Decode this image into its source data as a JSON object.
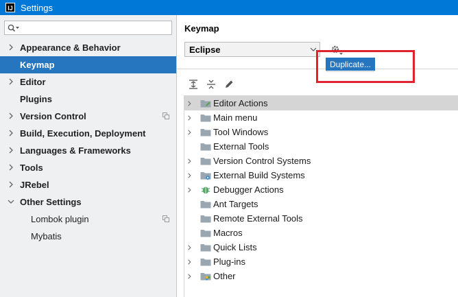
{
  "window": {
    "title": "Settings",
    "app_icon": "IJ"
  },
  "sidebar": {
    "search_placeholder": "",
    "items": [
      {
        "label": "Appearance & Behavior",
        "expandable": true,
        "selected": false
      },
      {
        "label": "Keymap",
        "expandable": false,
        "selected": true
      },
      {
        "label": "Editor",
        "expandable": true,
        "selected": false
      },
      {
        "label": "Plugins",
        "expandable": false,
        "selected": false
      },
      {
        "label": "Version Control",
        "expandable": true,
        "selected": false,
        "project_icon": true
      },
      {
        "label": "Build, Execution, Deployment",
        "expandable": true,
        "selected": false
      },
      {
        "label": "Languages & Frameworks",
        "expandable": true,
        "selected": false
      },
      {
        "label": "Tools",
        "expandable": true,
        "selected": false
      },
      {
        "label": "JRebel",
        "expandable": true,
        "selected": false
      },
      {
        "label": "Other Settings",
        "expandable": true,
        "expanded": true,
        "selected": false
      },
      {
        "label": "Lombok plugin",
        "child": true,
        "project_icon": true
      },
      {
        "label": "Mybatis",
        "child": true
      }
    ]
  },
  "main": {
    "heading": "Keymap",
    "keymap_select": {
      "value": "Eclipse"
    },
    "duplicate_label": "Duplicate...",
    "tree": [
      {
        "label": "Editor Actions",
        "expandable": true,
        "icon": "folder-edit-icon",
        "selected": true
      },
      {
        "label": "Main menu",
        "expandable": true,
        "icon": "folder-icon"
      },
      {
        "label": "Tool Windows",
        "expandable": true,
        "icon": "folder-icon"
      },
      {
        "label": "External Tools",
        "expandable": false,
        "icon": "folder-icon"
      },
      {
        "label": "Version Control Systems",
        "expandable": true,
        "icon": "folder-icon"
      },
      {
        "label": "External Build Systems",
        "expandable": true,
        "icon": "folder-gear-icon"
      },
      {
        "label": "Debugger Actions",
        "expandable": true,
        "icon": "bug-icon"
      },
      {
        "label": "Ant Targets",
        "expandable": false,
        "icon": "folder-icon"
      },
      {
        "label": "Remote External Tools",
        "expandable": false,
        "icon": "folder-icon"
      },
      {
        "label": "Macros",
        "expandable": false,
        "icon": "folder-icon"
      },
      {
        "label": "Quick Lists",
        "expandable": true,
        "icon": "folder-icon"
      },
      {
        "label": "Plug-ins",
        "expandable": true,
        "icon": "folder-icon"
      },
      {
        "label": "Other",
        "expandable": true,
        "icon": "folder-other-icon"
      }
    ]
  },
  "colors": {
    "titlebar": "#0078d7",
    "selection": "#2675bf",
    "highlight": "#e02130"
  }
}
